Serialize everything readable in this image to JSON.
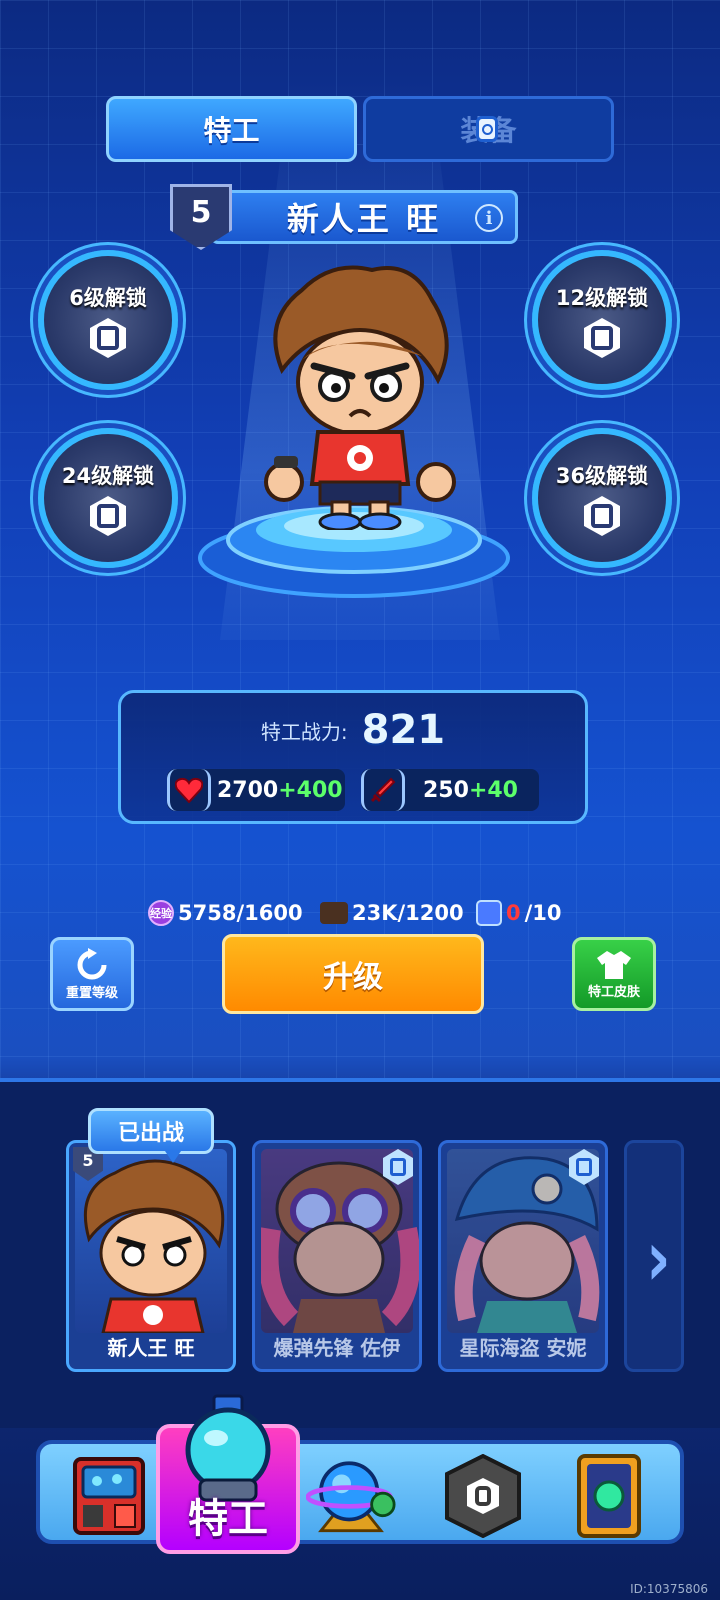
{
  "tabs": [
    {
      "label": "特工",
      "active": true
    },
    {
      "label": "装备",
      "locked": true
    }
  ],
  "agent": {
    "level": "5",
    "name": "新人王 旺"
  },
  "skills": [
    {
      "label": "6级解锁"
    },
    {
      "label": "12级解锁"
    },
    {
      "label": "24级解锁"
    },
    {
      "label": "36级解锁"
    }
  ],
  "power": {
    "label": "特工战力:",
    "value": "821",
    "hp": {
      "base": "2700",
      "bonus": "+400"
    },
    "atk": {
      "base": "250",
      "bonus": "+40"
    }
  },
  "resources": {
    "exp_icon": "经验",
    "exp": "5758/1600",
    "cash": "23K/1200",
    "card_current": "0",
    "card_total": "/10"
  },
  "buttons": {
    "reset": "重置等级",
    "upgrade": "升级",
    "skin": "特工皮肤"
  },
  "roster": {
    "deployed_label": "已出战",
    "cards": [
      {
        "name": "新人王 旺",
        "level": "5",
        "locked": false
      },
      {
        "name": "爆弹先锋 佐伊",
        "locked": true
      },
      {
        "name": "星际海盗 安妮",
        "locked": true
      }
    ]
  },
  "nav": {
    "active_label": "特工"
  },
  "colors": {
    "accent_blue": "#35b8ff",
    "upgrade_orange": "#ff8a00",
    "skin_green": "#139a28",
    "bonus_green": "#5cff6a",
    "nav_active_pink": "#d100e0",
    "card_counter_red": "#ff3b3b"
  },
  "watermark": "ID:10375806"
}
